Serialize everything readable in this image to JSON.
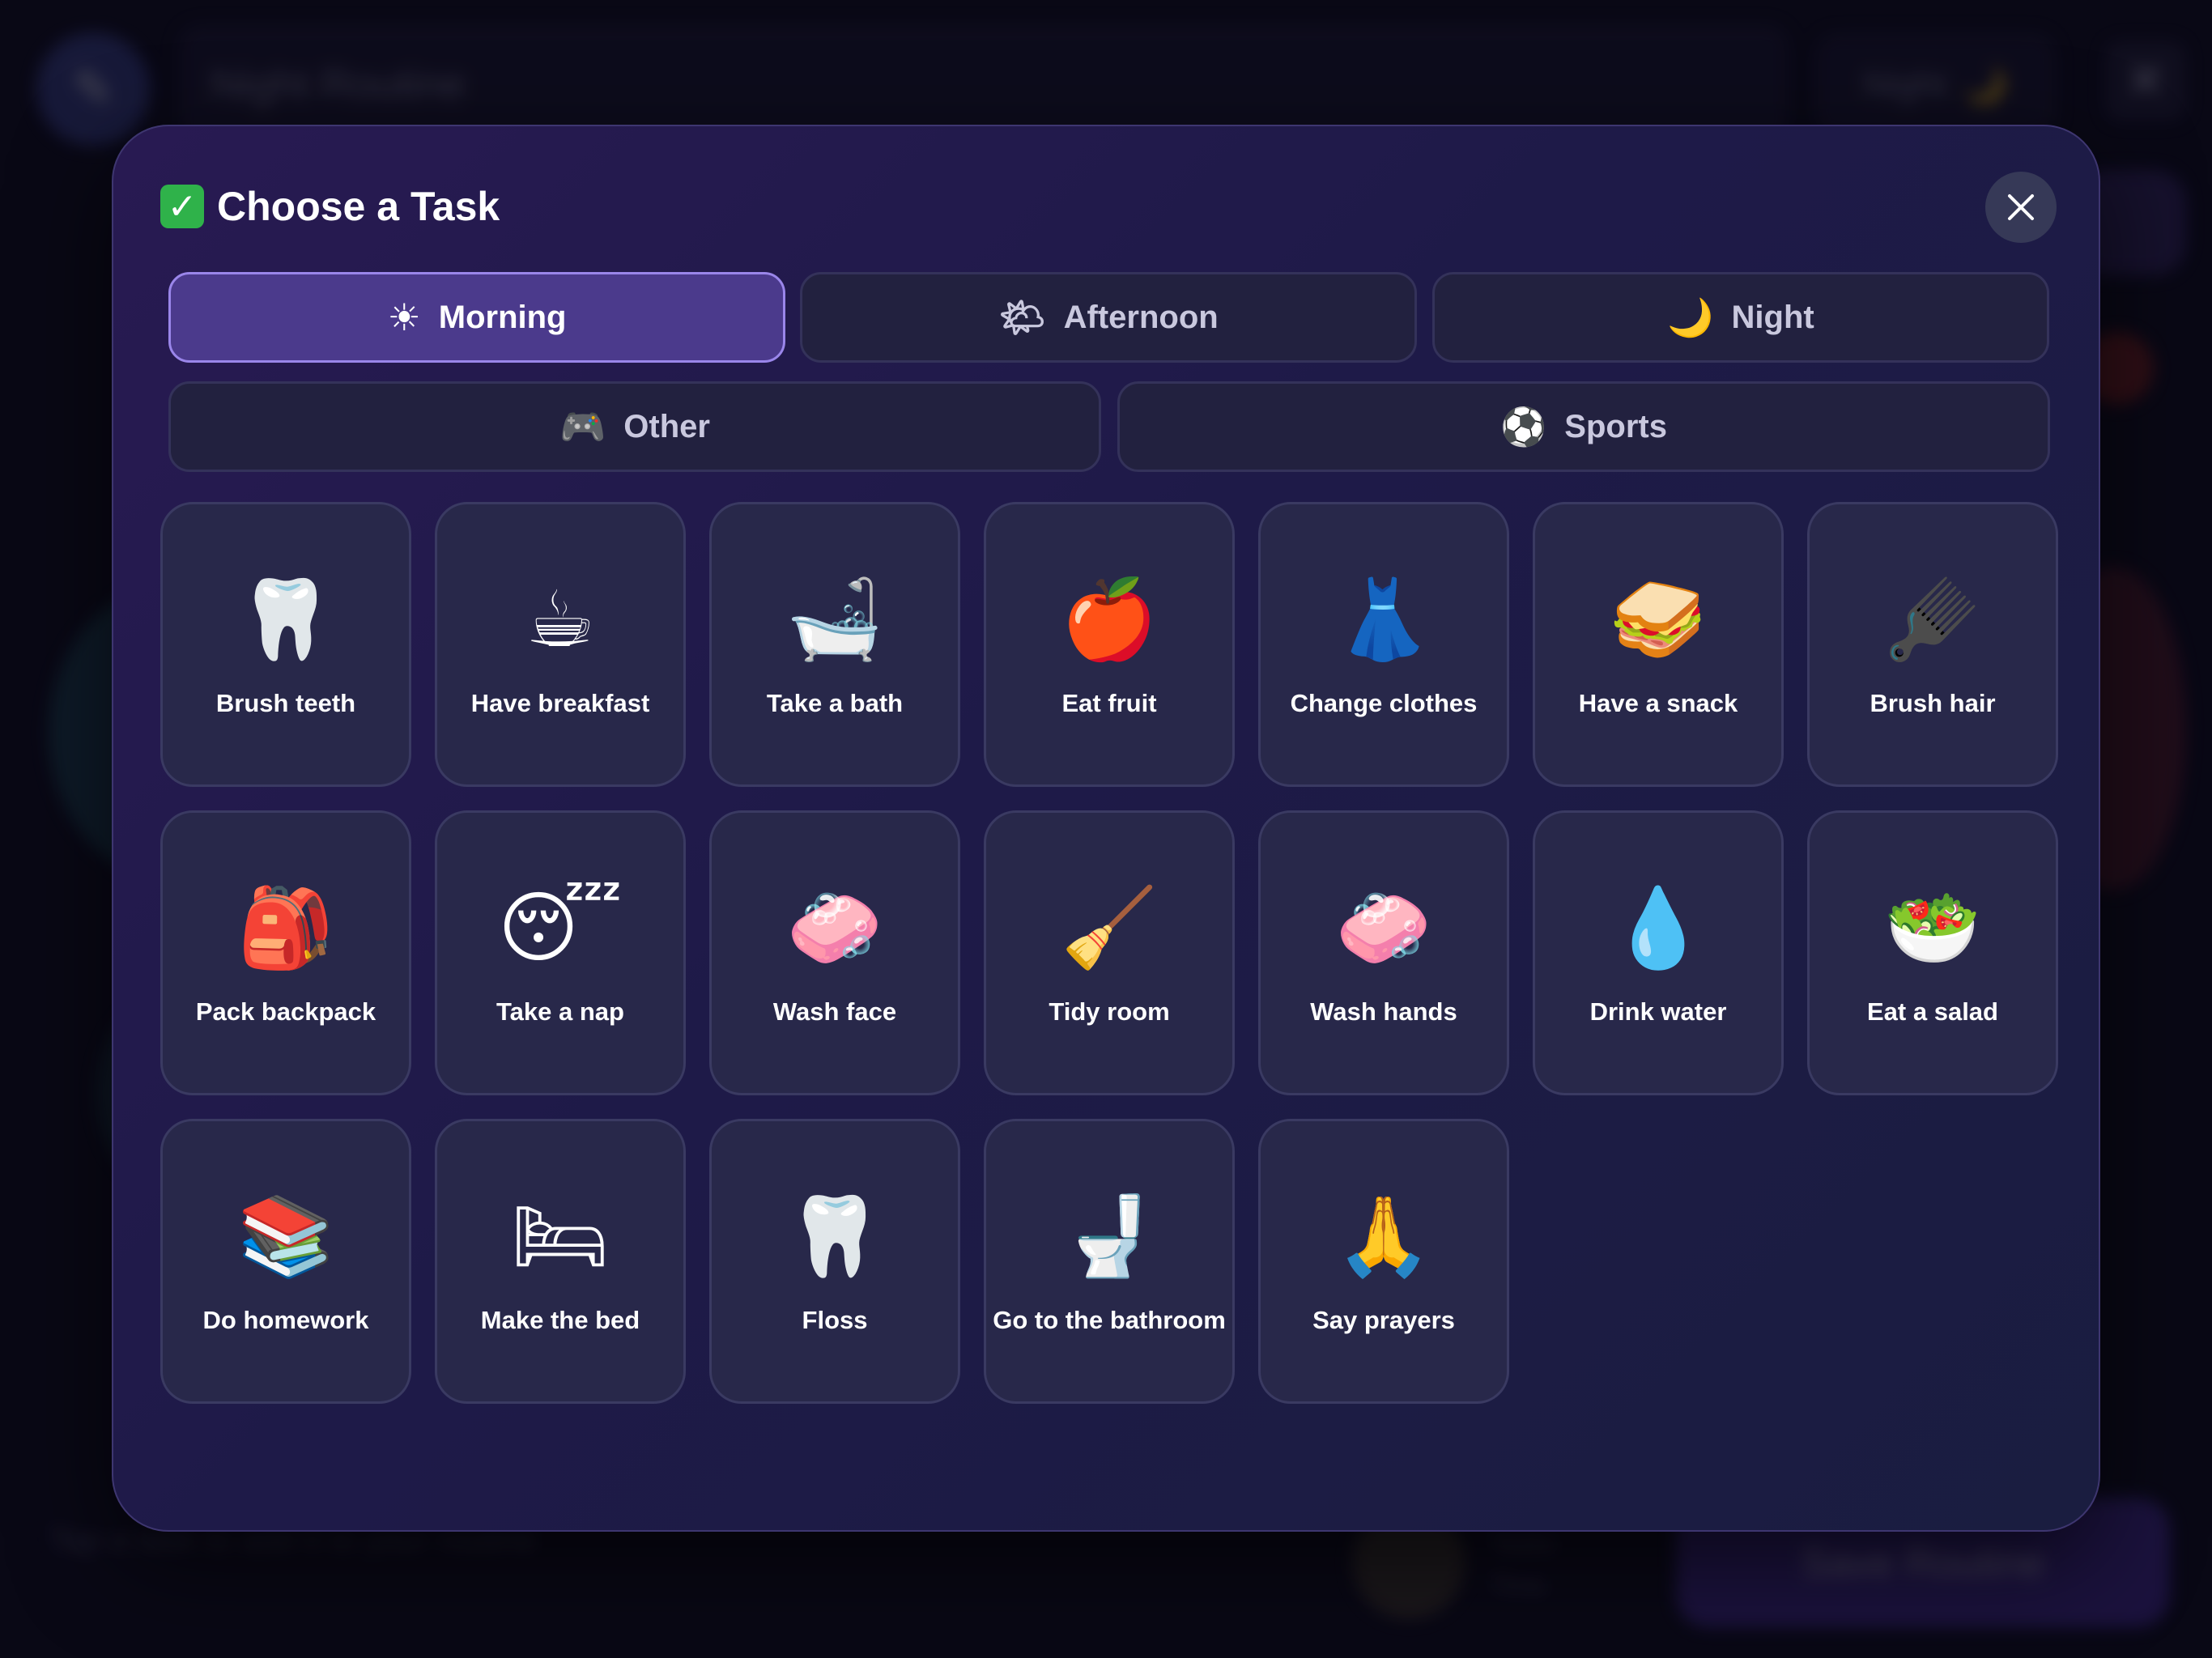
{
  "background": {
    "routine_name": "Night Routine",
    "period_pill": "Night",
    "period_pill_icon": "crescent-moon-icon",
    "footer_tip": "Tap a task to add it to your routine",
    "footer_meta_1": "Tasks",
    "footer_meta_2": "Time",
    "save_button": "Save Routine"
  },
  "modal": {
    "title": "Choose a Task",
    "title_icon": "check-mark-button-icon",
    "close_icon": "close-icon"
  },
  "tabs": [
    {
      "label": "Morning",
      "icon": "☀",
      "icon_name": "sun-icon",
      "active": true
    },
    {
      "label": "Afternoon",
      "icon": "🌤",
      "icon_name": "sun-behind-cloud-icon",
      "active": false
    },
    {
      "label": "Night",
      "icon": "🌙",
      "icon_name": "crescent-moon-icon",
      "active": false
    },
    {
      "label": "Other",
      "icon": "🎮",
      "icon_name": "gamepad-icon",
      "active": false
    },
    {
      "label": "Sports",
      "icon": "⚽",
      "icon_name": "soccer-ball-icon",
      "active": false
    }
  ],
  "tasks": [
    {
      "label": "Brush teeth",
      "icon": "🦷",
      "icon_name": "tooth-icon"
    },
    {
      "label": "Have breakfast",
      "icon": "☕",
      "icon_name": "coffee-icon"
    },
    {
      "label": "Take a bath",
      "icon": "🛁",
      "icon_name": "bathtub-icon"
    },
    {
      "label": "Eat fruit",
      "icon": "🍎",
      "icon_name": "apple-icon"
    },
    {
      "label": "Change clothes",
      "icon": "👗",
      "icon_name": "dress-icon"
    },
    {
      "label": "Have a snack",
      "icon": "🥪",
      "icon_name": "sandwich-icon"
    },
    {
      "label": "Brush hair",
      "icon": "🪮",
      "icon_name": "hair-pick-icon"
    },
    {
      "label": "Pack backpack",
      "icon": "🎒",
      "icon_name": "backpack-icon"
    },
    {
      "label": "Take a nap",
      "icon": "😴",
      "icon_name": "sleeping-face-icon"
    },
    {
      "label": "Wash face",
      "icon": "🧼",
      "icon_name": "soap-icon"
    },
    {
      "label": "Tidy room",
      "icon": "🧹",
      "icon_name": "broom-icon"
    },
    {
      "label": "Wash hands",
      "icon": "🧼",
      "icon_name": "soap-icon"
    },
    {
      "label": "Drink water",
      "icon": "💧",
      "icon_name": "droplet-icon"
    },
    {
      "label": "Eat a salad",
      "icon": "🥗",
      "icon_name": "salad-icon"
    },
    {
      "label": "Do homework",
      "icon": "📚",
      "icon_name": "books-icon"
    },
    {
      "label": "Make the bed",
      "icon": "🛏",
      "icon_name": "bed-icon"
    },
    {
      "label": "Floss",
      "icon": "🦷",
      "icon_name": "tooth-icon"
    },
    {
      "label": "Go to the bathroom",
      "icon": "🚽",
      "icon_name": "toilet-icon"
    },
    {
      "label": "Say prayers",
      "icon": "🙏",
      "icon_name": "folded-hands-icon"
    }
  ],
  "colors": {
    "modal_bg": "#231b4c",
    "card_bg": "#28284a",
    "active_tab_bg": "#4b3a8c",
    "active_tab_border": "#9a86ea",
    "check_green": "#2fb24a"
  }
}
